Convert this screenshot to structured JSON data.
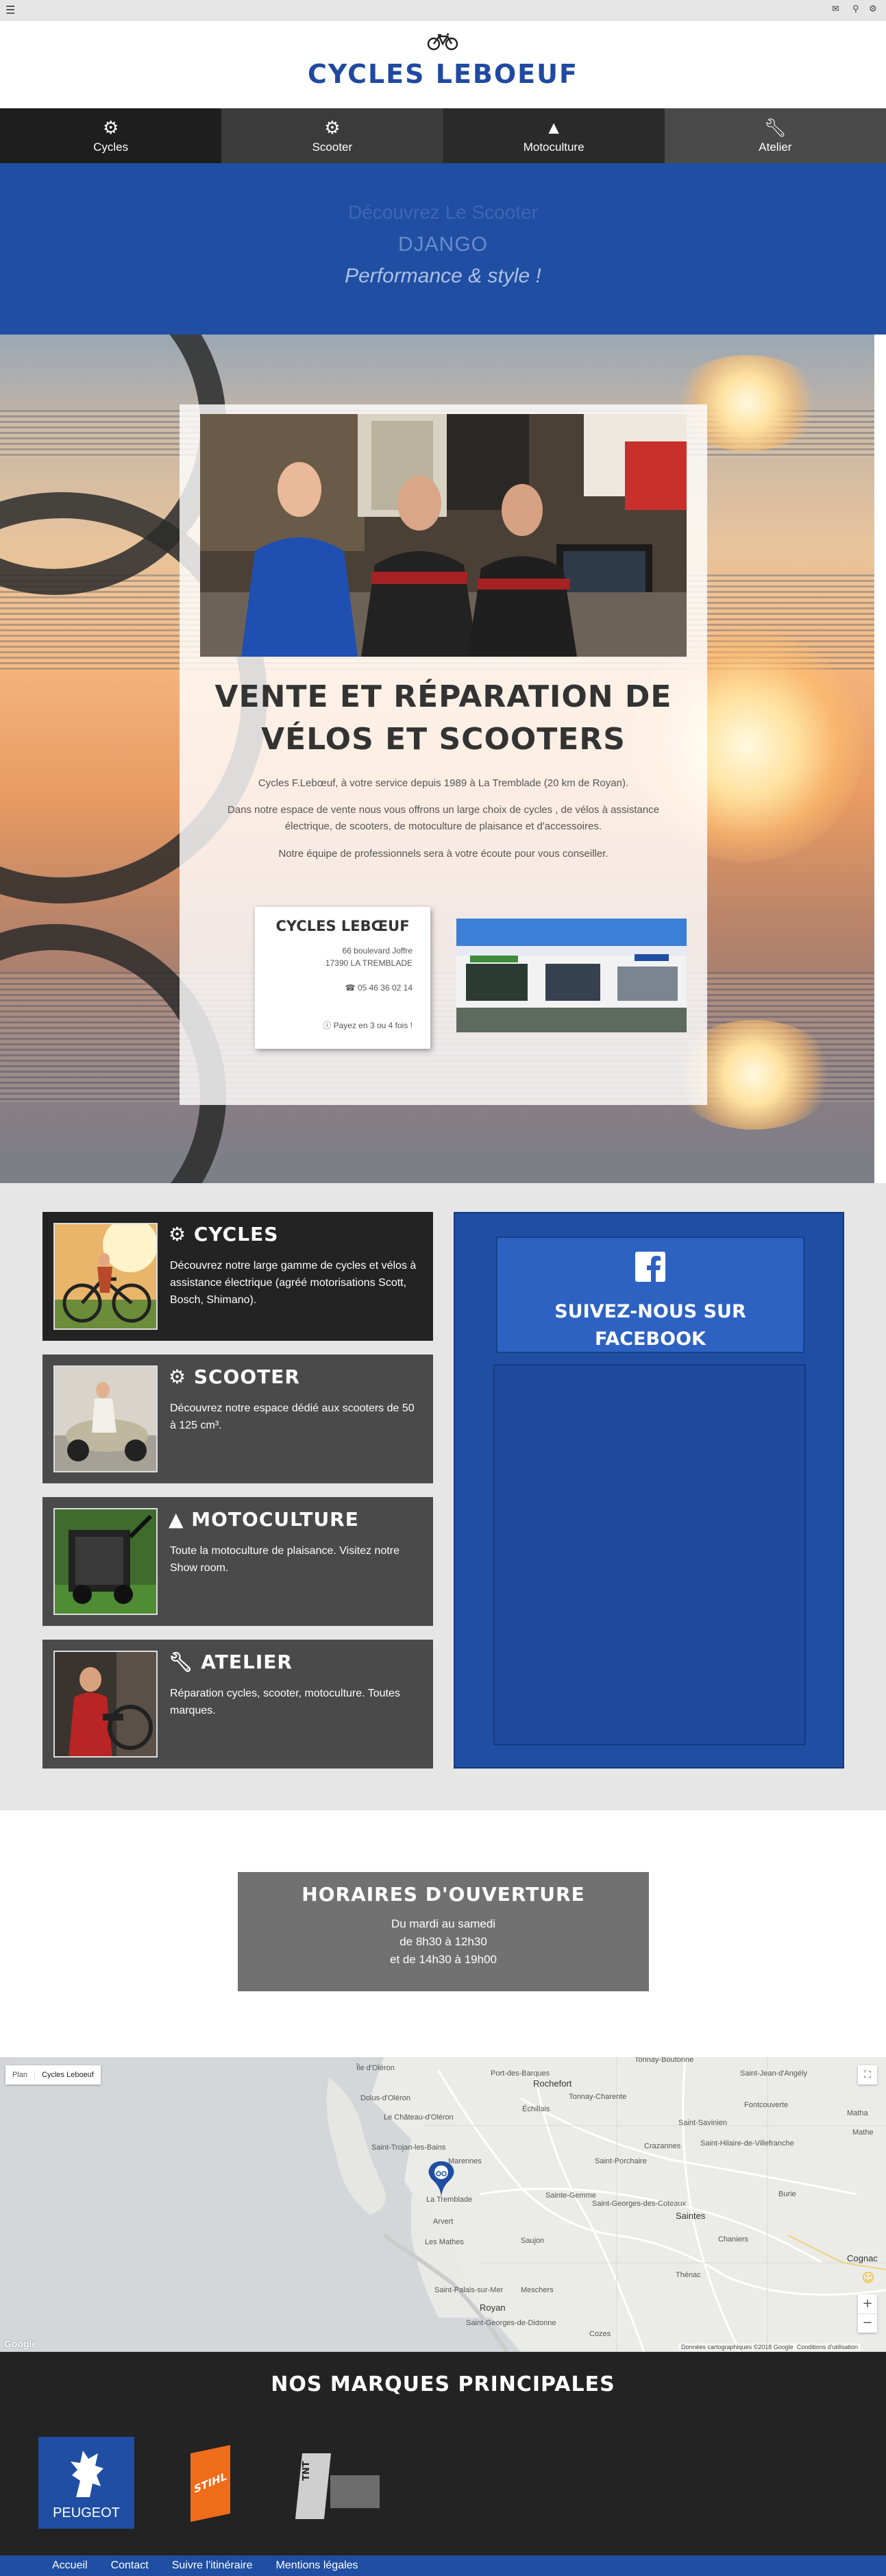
{
  "topbar": {
    "icons": [
      "menu-icon",
      "mail-icon",
      "location-pin-icon",
      "gear-icon"
    ]
  },
  "header": {
    "logo_text": "CYCLES LEBOEUF",
    "logo_icon": "bicycle-icon"
  },
  "nav": {
    "items": [
      {
        "label": "Cycles",
        "icon": "gear-icon",
        "bg": "#1e1e1e"
      },
      {
        "label": "Scooter",
        "icon": "cogs-icon",
        "bg": "#3b3b3b"
      },
      {
        "label": "Motoculture",
        "icon": "tree-icon",
        "bg": "#2a2a2a"
      },
      {
        "label": "Atelier",
        "icon": "wrench-icon",
        "bg": "#4a4a4a"
      }
    ]
  },
  "promo": {
    "line1": "Découvrez Le Scooter",
    "line2": "DJANGO",
    "line3": "Performance & style !",
    "bg": "#1f4ea3"
  },
  "hero": {
    "title": "VENTE ET RÉPARATION DE VÉLOS ET SCOOTERS",
    "p1": "Cycles F.Lebœuf, à votre service depuis 1989 à La Tremblade (20 km de Royan).",
    "p2": "Dans notre espace de vente nous vous offrons un large choix de cycles , de vélos à assistance électrique, de scooters, de motoculture de plaisance et d'accessoires.",
    "p3": "Notre équipe de professionnels sera à votre écoute pour vous conseiller.",
    "card": {
      "title": "CYCLES LEBŒUF",
      "address1": "66 boulevard Joffre",
      "address2": "17390 LA TREMBLADE",
      "phone": "05 46 36 02 14",
      "payment": "Payez en 3 ou 4 fois !"
    }
  },
  "categories": [
    {
      "title": "CYCLES",
      "icon": "gear-icon",
      "desc": "Découvrez notre large gamme de cycles et vélos à assistance électrique (agréé motorisations Scott, Bosch, Shimano)."
    },
    {
      "title": "SCOOTER",
      "icon": "cogs-icon",
      "desc": "Découvrez notre espace dédié aux scooters de 50 à 125 cm³."
    },
    {
      "title": "MOTOCULTURE",
      "icon": "tree-icon",
      "desc": "Toute la motoculture de plaisance. Visitez notre Show room."
    },
    {
      "title": "ATELIER",
      "icon": "wrench-icon",
      "desc": "Réparation cycles, scooter, motoculture. Toutes marques."
    }
  ],
  "facebook": {
    "title": "SUIVEZ-NOUS SUR FACEBOOK",
    "icon": "facebook-icon"
  },
  "hours": {
    "title": "HORAIRES D'OUVERTURE",
    "line1": "Du mardi au samedi",
    "line2": "de 8h30 à 12h30",
    "line3": "et de 14h30 à 19h00"
  },
  "map": {
    "tab_plan": "Plan",
    "tab_place": "Cycles Leboeuf",
    "places": [
      "Île d'Oléron",
      "Port-des-Barques",
      "Rochefort",
      "Tonnay-Boutonne",
      "Saint-Jean-d'Angély",
      "Dolus-d'Oléron",
      "Échillais",
      "Tonnay-Charente",
      "Le Château-d'Oléron",
      "Saint-Hilaire-de-Villefranche",
      "Saint-Trojan-les-Bains",
      "Marennes",
      "Saintes",
      "Saint-Porchaire",
      "La Tremblade",
      "Saint-Georges-des-Coteaux",
      "Arvert",
      "Saujon",
      "Les Mathes",
      "Royan",
      "Cognac",
      "Saint-Palais-sur-Mer",
      "Meschers",
      "Crazannes",
      "Burie",
      "Chaniers",
      "Thénac",
      "Sainte-Gemme",
      "Mathe",
      "Cozes",
      "Saint-Georges-de-Didonne",
      "Fontcouverte",
      "Saint-Savinien",
      "Matha"
    ],
    "google": "Google",
    "attribution": "Données cartographiques ©2018 Google",
    "terms": "Conditions d'utilisation"
  },
  "brands": {
    "title": "NOS MARQUES PRINCIPALES",
    "items": [
      {
        "name": "PEUGEOT",
        "text": "PEUGEOT"
      },
      {
        "name": "STIHL",
        "text": "STIHL"
      },
      {
        "name": "TNT MOTOR",
        "text": "TNT"
      }
    ]
  },
  "footer": {
    "links": [
      "Accueil",
      "Contact",
      "Suivre l'itinéraire",
      "Mentions légales"
    ]
  }
}
